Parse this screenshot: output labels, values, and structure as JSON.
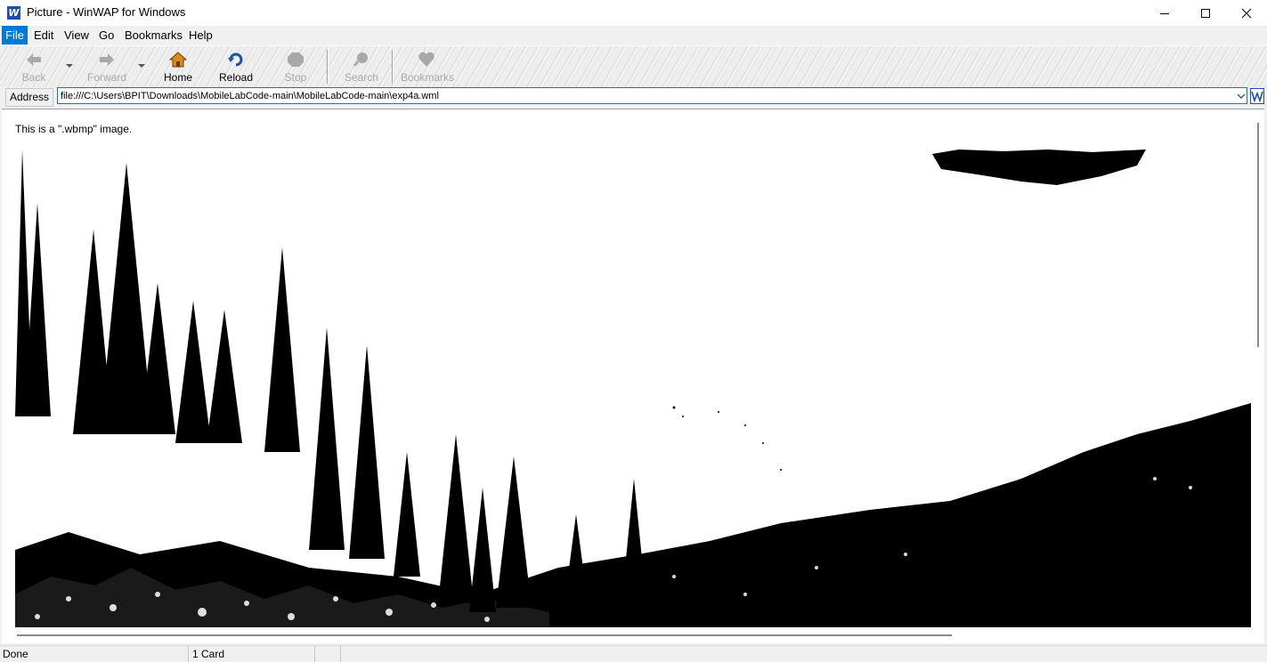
{
  "window": {
    "title": "Picture - WinWAP for Windows",
    "app_icon_letter": "W"
  },
  "menu": {
    "items": [
      "File",
      "Edit",
      "View",
      "Go",
      "Bookmarks",
      "Help"
    ]
  },
  "toolbar": {
    "back_label": "Back",
    "forward_label": "Forward",
    "home_label": "Home",
    "reload_label": "Reload",
    "stop_label": "Stop",
    "search_label": "Search",
    "bookmarks_label": "Bookmarks"
  },
  "address": {
    "label": "Address",
    "value": "file:///C:\\Users\\BPIT\\Downloads\\MobileLabCode-main\\MobileLabCode-main\\exp4a.wml"
  },
  "content": {
    "caption": "This is a \".wbmp\" image."
  },
  "status": {
    "state": "Done",
    "cards": "1 Card"
  },
  "colors": {
    "accent": "#0078d7",
    "home_icon": "#d98a1c",
    "reload_icon": "#1d4fa8",
    "disabled_icon": "#a8a8a8"
  },
  "icons": {
    "app": "winwap-logo-icon",
    "back": "back-arrow-icon",
    "forward": "forward-arrow-icon",
    "home": "home-icon",
    "reload": "reload-icon",
    "stop": "stop-icon",
    "search": "search-icon",
    "bookmarks": "heart-icon"
  }
}
